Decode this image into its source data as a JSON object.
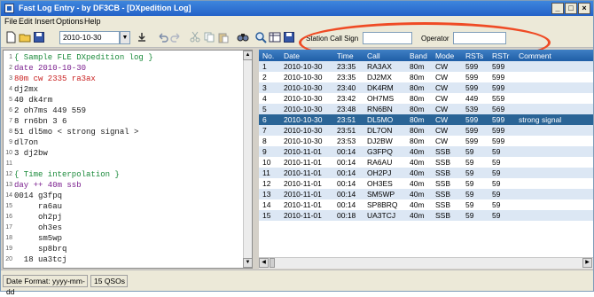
{
  "window": {
    "title": "Fast Log Entry - by DF3CB - [DXpedition Log]"
  },
  "menu": [
    "File",
    "Edit",
    "Insert",
    "Options",
    "Help"
  ],
  "toolbar": {
    "date_value": "2010-10-30",
    "station_call_sign_label": "Station Call Sign",
    "station_call_sign_value": "",
    "operator_label": "Operator",
    "operator_value": ""
  },
  "editor": {
    "lines": [
      {
        "n": "1",
        "text": "{ Sample FLE DXpedition log }",
        "color": "#1a8a3a"
      },
      {
        "n": "2",
        "text": "date 2010-10-30",
        "color": "#7a1e8e"
      },
      {
        "n": "3",
        "text": "80m cw 2335 ra3ax",
        "color": "#c81e1e"
      },
      {
        "n": "4",
        "text": "dj2mx",
        "color": "#1a1a1a"
      },
      {
        "n": "5",
        "text": "40 dk4rm",
        "color": "#1a1a1a"
      },
      {
        "n": "6",
        "text": "2 oh7ms 449 559",
        "color": "#1a1a1a"
      },
      {
        "n": "7",
        "text": "8 rn6bn 3 6",
        "color": "#1a1a1a"
      },
      {
        "n": "8",
        "text": "51 dl5mo < strong signal >",
        "color": "#1a1a1a"
      },
      {
        "n": "9",
        "text": "dl7on",
        "color": "#1a1a1a"
      },
      {
        "n": "10",
        "text": "3 dj2bw",
        "color": "#1a1a1a"
      },
      {
        "n": "11",
        "text": "",
        "color": "#1a1a1a"
      },
      {
        "n": "12",
        "text": "{ Time interpolation }",
        "color": "#1a8a3a"
      },
      {
        "n": "13",
        "text": "day ++ 40m ssb",
        "color": "#7a1e8e"
      },
      {
        "n": "14",
        "text": "0014 g3fpq",
        "color": "#1a1a1a"
      },
      {
        "n": "15",
        "text": "     ra6au",
        "color": "#1a1a1a"
      },
      {
        "n": "16",
        "text": "     oh2pj",
        "color": "#1a1a1a"
      },
      {
        "n": "17",
        "text": "     oh3es",
        "color": "#1a1a1a"
      },
      {
        "n": "18",
        "text": "     sm5wp",
        "color": "#1a1a1a"
      },
      {
        "n": "19",
        "text": "     sp8brq",
        "color": "#1a1a1a"
      },
      {
        "n": "20",
        "text": "  18 ua3tcj",
        "color": "#1a1a1a"
      }
    ]
  },
  "log": {
    "columns": [
      "No.",
      "Date",
      "Time",
      "Call",
      "Band",
      "Mode",
      "RSTs",
      "RSTr",
      "Comment"
    ],
    "rows": [
      [
        "1",
        "2010-10-30",
        "23:35",
        "RA3AX",
        "80m",
        "CW",
        "599",
        "599",
        ""
      ],
      [
        "2",
        "2010-10-30",
        "23:35",
        "DJ2MX",
        "80m",
        "CW",
        "599",
        "599",
        ""
      ],
      [
        "3",
        "2010-10-30",
        "23:40",
        "DK4RM",
        "80m",
        "CW",
        "599",
        "599",
        ""
      ],
      [
        "4",
        "2010-10-30",
        "23:42",
        "OH7MS",
        "80m",
        "CW",
        "449",
        "559",
        ""
      ],
      [
        "5",
        "2010-10-30",
        "23:48",
        "RN6BN",
        "80m",
        "CW",
        "539",
        "569",
        ""
      ],
      [
        "6",
        "2010-10-30",
        "23:51",
        "DL5MO",
        "80m",
        "CW",
        "599",
        "599",
        "strong signal"
      ],
      [
        "7",
        "2010-10-30",
        "23:51",
        "DL7ON",
        "80m",
        "CW",
        "599",
        "599",
        ""
      ],
      [
        "8",
        "2010-10-30",
        "23:53",
        "DJ2BW",
        "80m",
        "CW",
        "599",
        "599",
        ""
      ],
      [
        "9",
        "2010-11-01",
        "00:14",
        "G3FPQ",
        "40m",
        "SSB",
        "59",
        "59",
        ""
      ],
      [
        "10",
        "2010-11-01",
        "00:14",
        "RA6AU",
        "40m",
        "SSB",
        "59",
        "59",
        ""
      ],
      [
        "11",
        "2010-11-01",
        "00:14",
        "OH2PJ",
        "40m",
        "SSB",
        "59",
        "59",
        ""
      ],
      [
        "12",
        "2010-11-01",
        "00:14",
        "OH3ES",
        "40m",
        "SSB",
        "59",
        "59",
        ""
      ],
      [
        "13",
        "2010-11-01",
        "00:14",
        "SM5WP",
        "40m",
        "SSB",
        "59",
        "59",
        ""
      ],
      [
        "14",
        "2010-11-01",
        "00:14",
        "SP8BRQ",
        "40m",
        "SSB",
        "59",
        "59",
        ""
      ],
      [
        "15",
        "2010-11-01",
        "00:18",
        "UA3TCJ",
        "40m",
        "SSB",
        "59",
        "59",
        ""
      ]
    ],
    "selected_row": 6
  },
  "status": {
    "date_format": "Date Format: yyyy-mm-dd",
    "qso_count": "15 QSOs"
  },
  "colors": {
    "header_blue": "#2a6db5",
    "alt_row": "#dce7f4",
    "selected_row": "#2a6496",
    "annotation": "#ef4b25"
  }
}
